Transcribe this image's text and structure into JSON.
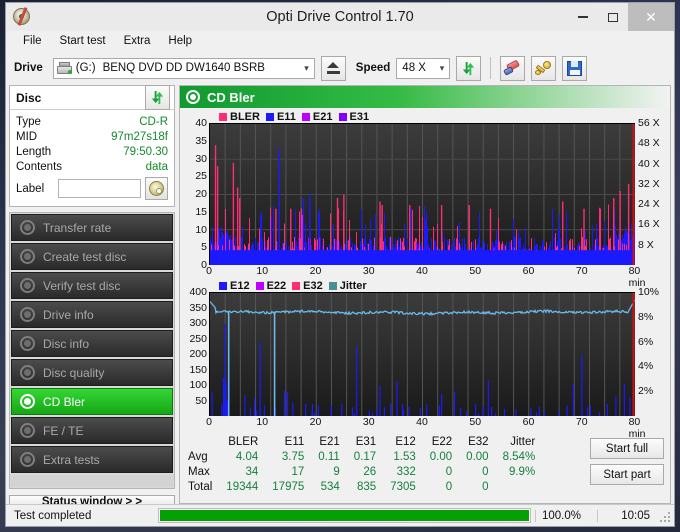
{
  "window": {
    "title": "Opti Drive Control 1.70",
    "app_icon": "disc-icon",
    "minimize": "–",
    "maximize": "▢",
    "close": "✕"
  },
  "menu": {
    "items": [
      "File",
      "Start test",
      "Extra",
      "Help"
    ]
  },
  "drivebar": {
    "drive_label": "Drive",
    "drive_letter": "(G:)",
    "drive_name": "BENQ DVD DD DW1640 BSRB",
    "eject_icon": "eject-icon",
    "speed_label": "Speed",
    "speed_value": "48 X",
    "refresh_icon": "refresh-icon",
    "eraser_icon": "eraser-icon",
    "key_icon": "key-icon",
    "save_icon": "save-icon"
  },
  "disc_panel": {
    "title": "Disc",
    "refresh_icon": "refresh-icon",
    "rows": [
      {
        "key": "Type",
        "value": "CD-R"
      },
      {
        "key": "MID",
        "value": "97m27s18f"
      },
      {
        "key": "Length",
        "value": "79:50.30"
      },
      {
        "key": "Contents",
        "value": "data"
      }
    ],
    "label_key": "Label",
    "label_value": "",
    "label_placeholder": "",
    "disc_icon": "cd-icon"
  },
  "nav": {
    "items": [
      {
        "label": "Transfer rate",
        "active": false
      },
      {
        "label": "Create test disc",
        "active": false
      },
      {
        "label": "Verify test disc",
        "active": false
      },
      {
        "label": "Drive info",
        "active": false
      },
      {
        "label": "Disc info",
        "active": false
      },
      {
        "label": "Disc quality",
        "active": false
      },
      {
        "label": "CD Bler",
        "active": true
      },
      {
        "label": "FE / TE",
        "active": false
      },
      {
        "label": "Extra tests",
        "active": false
      }
    ],
    "status_window_label": "Status window > >"
  },
  "panel": {
    "title": "CD Bler",
    "icon": "disc-icon"
  },
  "actions": {
    "start_full": "Start full",
    "start_part": "Start part"
  },
  "statusbar": {
    "status": "Test completed",
    "progress_pct": "100.0%",
    "progress_value": 100,
    "elapsed": "10:05",
    "grip_icon": "resize-grip-icon"
  },
  "colors": {
    "bler": "#ff2d78",
    "e11": "#1a1aff",
    "e21": "#c000ff",
    "e31": "#8000ff",
    "e12": "#1a1aff",
    "e22": "#c000ff",
    "e32": "#ff2d78",
    "jitter": "#4a8f96",
    "jitter_trace": "#6cb9ea",
    "speed_trace": "#d01010",
    "accent_green": "#15a715",
    "progress_green": "#05a005",
    "value_green": "#15803d"
  },
  "chart_data": [
    {
      "type": "line",
      "name": "cd-bler-errors",
      "title": "",
      "xlabel": "min",
      "ylabel": "",
      "xlim": [
        0,
        80
      ],
      "ylim": [
        0,
        40
      ],
      "xticks": [
        0,
        10,
        20,
        30,
        40,
        50,
        60,
        70,
        80
      ],
      "xticklabels": [
        "0",
        "10",
        "20",
        "30",
        "40",
        "50",
        "60",
        "70",
        "80 min"
      ],
      "yticks": [
        0,
        5,
        10,
        15,
        20,
        25,
        30,
        35,
        40
      ],
      "yticklabels": [
        "0",
        "5",
        "10",
        "15",
        "20",
        "25",
        "30",
        "35",
        "40"
      ],
      "y2lim": [
        0,
        56
      ],
      "y2ticks": [
        8,
        16,
        24,
        32,
        40,
        48,
        56
      ],
      "y2ticklabels": [
        "8 X",
        "16 X",
        "24 X",
        "32 X",
        "40 X",
        "48 X",
        "56 X"
      ],
      "grid": true,
      "legend": [
        "BLER",
        "E11",
        "E21",
        "E31"
      ],
      "legend_position": "top-left",
      "series": [
        {
          "name": "BLER",
          "color": "#ff2d78",
          "avg": 4.04,
          "max": 34,
          "total": 19344
        },
        {
          "name": "E11",
          "color": "#1a1aff",
          "avg": 3.75,
          "max": 17,
          "total": 17975
        },
        {
          "name": "E21",
          "color": "#c000ff",
          "avg": 0.11,
          "max": 9,
          "total": 534
        },
        {
          "name": "E31",
          "color": "#8000ff",
          "avg": 0.17,
          "max": 26,
          "total": 835
        }
      ]
    },
    {
      "type": "line",
      "name": "cd-bler-e12-jitter",
      "title": "",
      "xlabel": "min",
      "ylabel": "",
      "xlim": [
        0,
        80
      ],
      "ylim": [
        0,
        400
      ],
      "xticks": [
        0,
        10,
        20,
        30,
        40,
        50,
        60,
        70,
        80
      ],
      "xticklabels": [
        "0",
        "10",
        "20",
        "30",
        "40",
        "50",
        "60",
        "70",
        "80 min"
      ],
      "yticks": [
        50,
        100,
        150,
        200,
        250,
        300,
        350,
        400
      ],
      "yticklabels": [
        "50",
        "100",
        "150",
        "200",
        "250",
        "300",
        "350",
        "400"
      ],
      "y2lim": [
        0,
        10
      ],
      "y2ticks": [
        2,
        4,
        6,
        8,
        10
      ],
      "y2ticklabels": [
        "2%",
        "4%",
        "6%",
        "8%",
        "10%"
      ],
      "grid": true,
      "legend": [
        "E12",
        "E22",
        "E32",
        "Jitter"
      ],
      "legend_position": "top-left",
      "series": [
        {
          "name": "E12",
          "color": "#1a1aff",
          "avg": 1.53,
          "max": 332,
          "total": 7305
        },
        {
          "name": "E22",
          "color": "#c000ff",
          "avg": 0.0,
          "max": 0,
          "total": 0
        },
        {
          "name": "E32",
          "color": "#ff2d78",
          "avg": 0.0,
          "max": 0,
          "total": 0
        },
        {
          "name": "Jitter",
          "color": "#4a8f96",
          "avg": "8.54%",
          "max": "9.9%",
          "total": ""
        }
      ]
    },
    {
      "type": "table",
      "name": "cd-bler-statistics",
      "columns": [
        "",
        "BLER",
        "E11",
        "E21",
        "E31",
        "E12",
        "E22",
        "E32",
        "Jitter"
      ],
      "rows": [
        [
          "Avg",
          "4.04",
          "3.75",
          "0.11",
          "0.17",
          "1.53",
          "0.00",
          "0.00",
          "8.54%"
        ],
        [
          "Max",
          "34",
          "17",
          "9",
          "26",
          "332",
          "0",
          "0",
          "9.9%"
        ],
        [
          "Total",
          "19344",
          "17975",
          "534",
          "835",
          "7305",
          "0",
          "0",
          ""
        ]
      ]
    }
  ]
}
